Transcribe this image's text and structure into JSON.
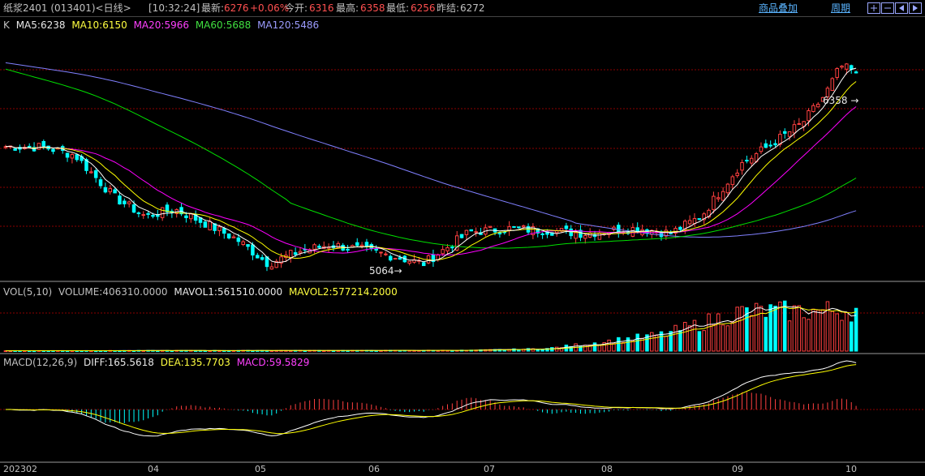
{
  "header": {
    "title": "纸浆2401 (013401)<日线>",
    "time": "[10:32:24]",
    "latest_label": "最新:",
    "latest": "6276",
    "change": "+0.06%",
    "open_label": "今开:",
    "open": "6316",
    "high_label": "最高:",
    "high": "6358",
    "low_label": "最低:",
    "low": "6256",
    "prev_label": "昨结:",
    "prev": "6272",
    "overlay_link": "商品叠加",
    "period_link": "周期",
    "nav_icons": [
      "zoom-in-icon",
      "zoom-out-icon",
      "scroll-left-icon",
      "scroll-right-icon"
    ]
  },
  "legend_price": {
    "k": "K",
    "ma5": "MA5:6238",
    "ma10": "MA10:6150",
    "ma20": "MA20:5966",
    "ma60": "MA60:5688",
    "ma120": "MA120:5486"
  },
  "legend_volume": {
    "name": "VOL(5,10)",
    "volume": "VOLUME:406310.0000",
    "mavol1": "MAVOL1:561510.0000",
    "mavol2": "MAVOL2:577214.2000"
  },
  "legend_macd": {
    "name": "MACD(12,26,9)",
    "diff": "DIFF:165.5618",
    "dea": "DEA:135.7703",
    "macd": "MACD:59.5829"
  },
  "markers": {
    "high": "6358",
    "low": "5064"
  },
  "x_axis": [
    "202302",
    "04",
    "05",
    "06",
    "07",
    "08",
    "09",
    "10"
  ],
  "colors": {
    "up": "#ff4040",
    "down": "#00ffff",
    "ma5": "#ffffff",
    "ma10": "#ffff00",
    "ma20": "#ff00ff",
    "ma60": "#00e000",
    "ma120": "#8080ff",
    "grid": "#8b0000"
  },
  "chart_data": {
    "type": "candlestick",
    "bars": 180,
    "y_range": [
      4980,
      6540
    ],
    "close_anchors": [
      [
        0,
        5815
      ],
      [
        10,
        5812
      ],
      [
        18,
        5760
      ],
      [
        28,
        5500
      ],
      [
        36,
        5380
      ],
      [
        44,
        5420
      ],
      [
        52,
        5330
      ],
      [
        60,
        5230
      ],
      [
        68,
        5080
      ],
      [
        76,
        5160
      ],
      [
        84,
        5200
      ],
      [
        92,
        5170
      ],
      [
        100,
        5130
      ],
      [
        108,
        5080
      ],
      [
        114,
        5180
      ],
      [
        120,
        5280
      ],
      [
        130,
        5300
      ],
      [
        140,
        5290
      ],
      [
        150,
        5270
      ],
      [
        160,
        5300
      ],
      [
        165,
        5300
      ],
      [
        172,
        5270
      ],
      [
        180,
        5380
      ],
      [
        190,
        5700
      ],
      [
        198,
        5830
      ],
      [
        206,
        5960
      ],
      [
        212,
        6140
      ],
      [
        216,
        6320
      ],
      [
        220,
        6276
      ]
    ],
    "ma120_start": 6340,
    "volume_profile": [
      [
        0,
        1
      ],
      [
        90,
        1.5
      ],
      [
        120,
        2
      ],
      [
        140,
        6
      ],
      [
        170,
        40
      ],
      [
        190,
        95
      ],
      [
        220,
        100
      ]
    ],
    "volume_max": 600000
  }
}
